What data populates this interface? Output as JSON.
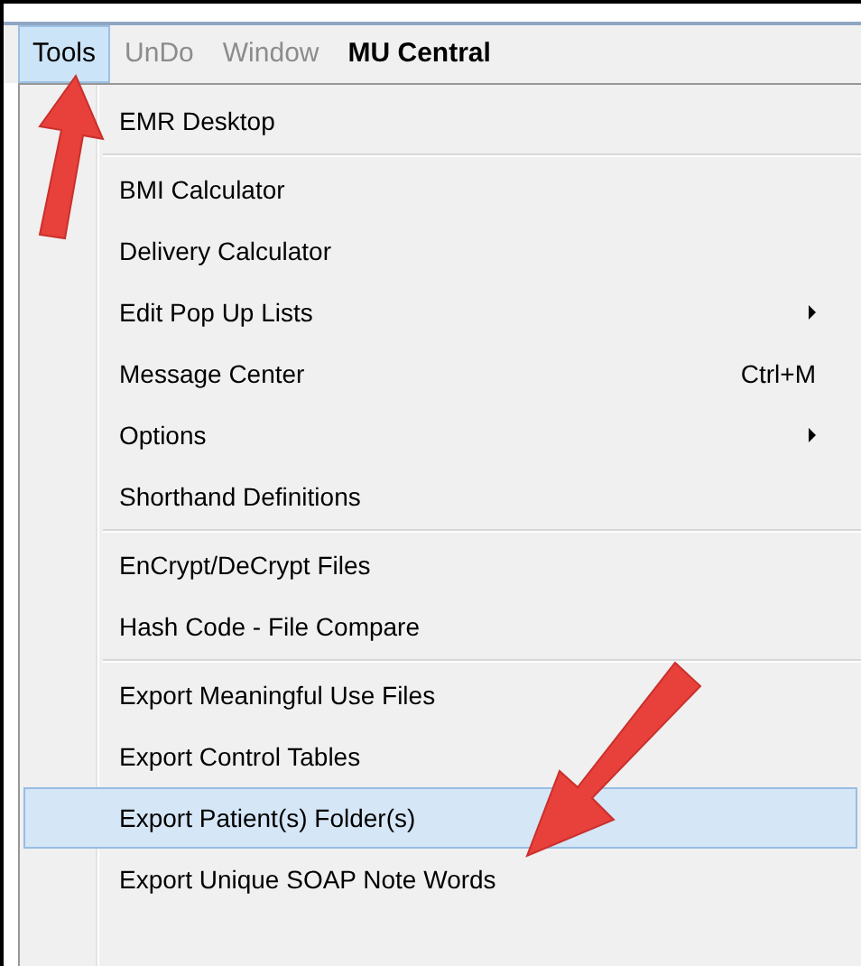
{
  "menubar": [
    {
      "label": "Tools",
      "selected": true,
      "disabled": false
    },
    {
      "label": "UnDo",
      "selected": false,
      "disabled": true
    },
    {
      "label": "Window",
      "selected": false,
      "disabled": true
    },
    {
      "label": "MU Central",
      "selected": false,
      "disabled": false
    }
  ],
  "menu": [
    {
      "kind": "item",
      "label": "EMR Desktop",
      "selected": false
    },
    {
      "kind": "separator"
    },
    {
      "kind": "item",
      "label": "BMI Calculator",
      "selected": false
    },
    {
      "kind": "item",
      "label": "Delivery Calculator",
      "selected": false
    },
    {
      "kind": "item",
      "label": "Edit Pop Up Lists",
      "selected": false,
      "submenu": true
    },
    {
      "kind": "item",
      "label": "Message Center",
      "selected": false,
      "shortcut": "Ctrl+M"
    },
    {
      "kind": "item",
      "label": "Options",
      "selected": false,
      "submenu": true
    },
    {
      "kind": "item",
      "label": "Shorthand Definitions",
      "selected": false
    },
    {
      "kind": "separator"
    },
    {
      "kind": "item",
      "label": "EnCrypt/DeCrypt Files",
      "selected": false
    },
    {
      "kind": "item",
      "label": "Hash Code - File Compare",
      "selected": false
    },
    {
      "kind": "separator"
    },
    {
      "kind": "item",
      "label": "Export Meaningful Use Files",
      "selected": false
    },
    {
      "kind": "item",
      "label": "Export Control Tables",
      "selected": false
    },
    {
      "kind": "item",
      "label": "Export Patient(s) Folder(s)",
      "selected": true
    },
    {
      "kind": "item",
      "label": "Export Unique SOAP Note Words",
      "selected": false
    }
  ]
}
